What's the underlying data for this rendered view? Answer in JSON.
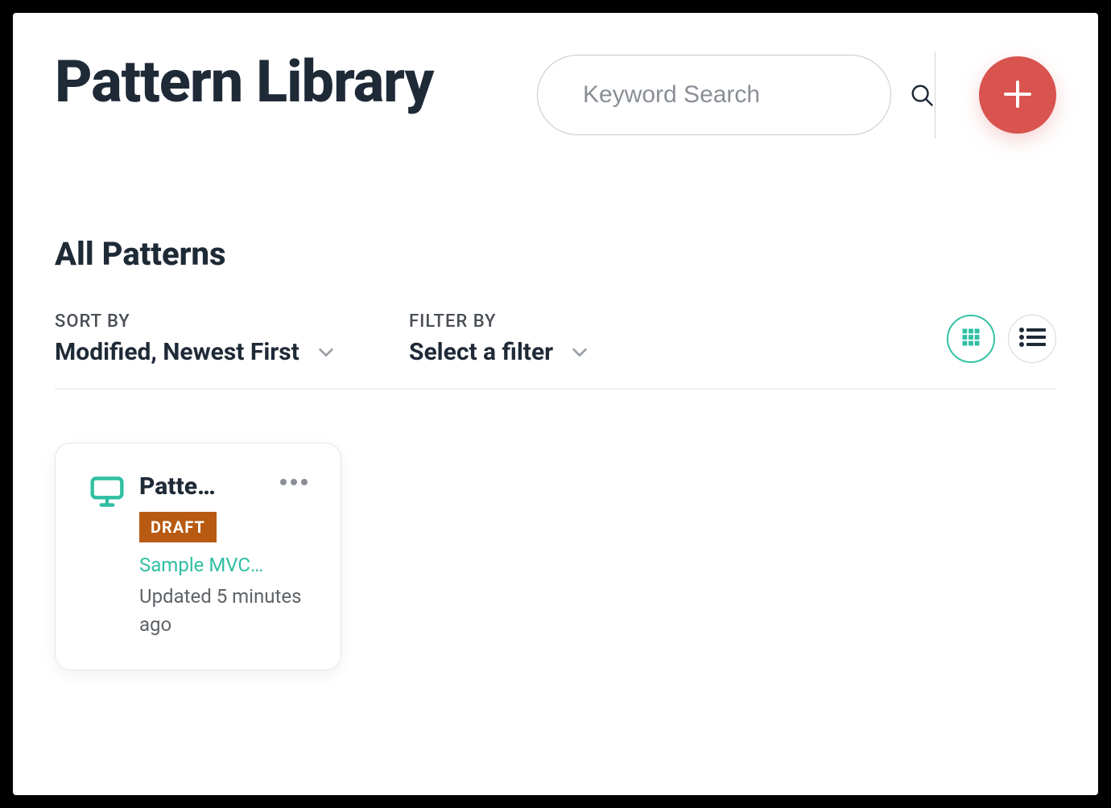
{
  "header": {
    "title": "Pattern Library",
    "search_placeholder": "Keyword Search"
  },
  "section": {
    "title": "All Patterns"
  },
  "controls": {
    "sort_label": "SORT BY",
    "sort_value": "Modified, Newest First",
    "filter_label": "FILTER BY",
    "filter_value": "Select a filter"
  },
  "view": {
    "active": "grid"
  },
  "cards": [
    {
      "title": "Patte…",
      "badge": "DRAFT",
      "link": "Sample MVC…",
      "meta": "Updated 5 minutes ago"
    }
  ],
  "colors": {
    "accent": "#d9534f",
    "teal": "#2fbfa3",
    "badge": "#b95a12"
  }
}
